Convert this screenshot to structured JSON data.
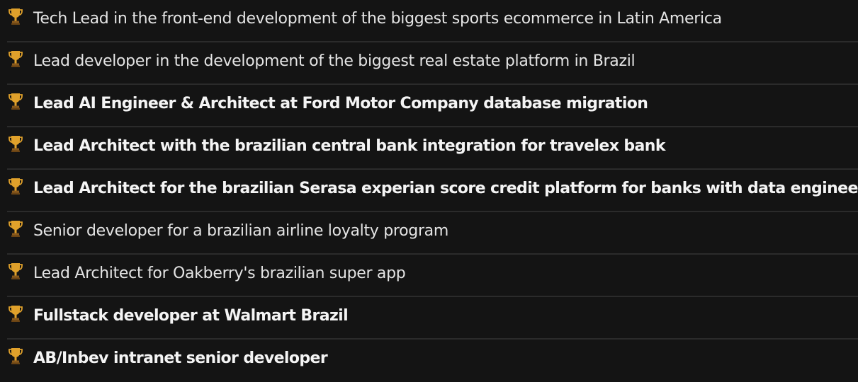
{
  "achievements": {
    "icon": "trophy-icon",
    "colors": {
      "background": "#141414",
      "text": "#ececec",
      "divider": "#2b2b2b",
      "trophy_gold": "#e0a12b"
    },
    "items": [
      {
        "label": "Tech Lead in the front-end development of the biggest sports ecommerce in Latin America",
        "style": "light"
      },
      {
        "label": "Lead developer in the development of the biggest real estate platform in Brazil",
        "style": "light"
      },
      {
        "label": "Lead AI Engineer & Architect at Ford Motor Company database migration",
        "style": "semibold"
      },
      {
        "label": "Lead Architect with the brazilian central bank integration for travelex bank",
        "style": "semibold"
      },
      {
        "label": "Lead Architect for the brazilian Serasa experian score credit platform for banks with data engineering",
        "style": "semibold"
      },
      {
        "label": "Senior developer for a brazilian airline loyalty program",
        "style": "light"
      },
      {
        "label": "Lead Architect for Oakberry's brazilian super app",
        "style": "light"
      },
      {
        "label": "Fullstack developer at Walmart Brazil",
        "style": "semibold"
      },
      {
        "label": "AB/Inbev intranet senior developer",
        "style": "semibold"
      }
    ]
  }
}
